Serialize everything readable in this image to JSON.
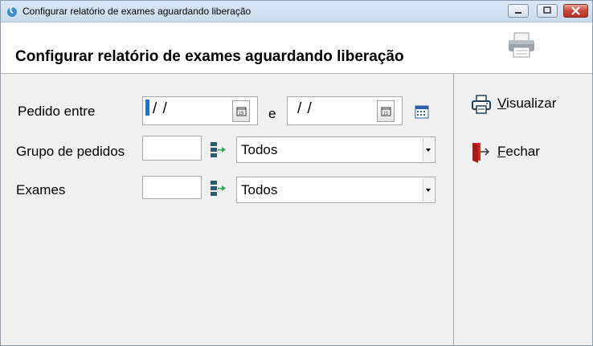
{
  "window": {
    "title": "Configurar relatório de exames aguardando liberação"
  },
  "header": {
    "title": "Configurar relatório de exames aguardando liberação"
  },
  "form": {
    "pedido_label": "Pedido entre",
    "date_start": "/ /",
    "date_separator": "e",
    "date_end": "/ /",
    "grupo_label": "Grupo de pedidos",
    "grupo_code": "",
    "grupo_select": "Todos",
    "exames_label": "Exames",
    "exames_code": "",
    "exames_select": "Todos"
  },
  "actions": {
    "visualizar": "Visualizar",
    "fechar": "Fechar"
  },
  "colors": {
    "accent_blue": "#1a72d8",
    "close_red": "#c7463a",
    "icon_teal": "#2b5b6e",
    "icon_green": "#2fa84f"
  },
  "icons": [
    "app-icon",
    "minimize-icon",
    "maximize-icon",
    "close-icon",
    "printer-icon",
    "calendar-icon",
    "calendar-grid-icon",
    "lookup-icon",
    "exit-door-icon"
  ]
}
